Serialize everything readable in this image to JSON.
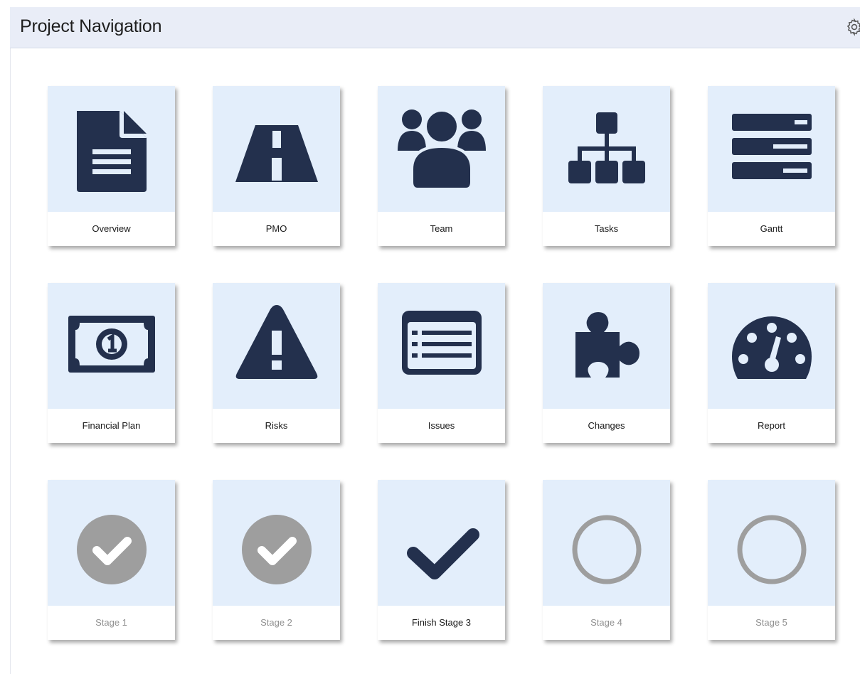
{
  "header": {
    "title": "Project Navigation",
    "settings_icon": "gear-icon"
  },
  "colors": {
    "header_bg": "#e9edf7",
    "tile_bg": "#e3eefb",
    "icon_dark": "#23304d",
    "icon_gray": "#9e9e9e",
    "label_muted": "#909090"
  },
  "tiles": [
    {
      "label": "Overview",
      "icon": "document-icon",
      "state": "active"
    },
    {
      "label": "PMO",
      "icon": "road-icon",
      "state": "active"
    },
    {
      "label": "Team",
      "icon": "users-icon",
      "state": "active"
    },
    {
      "label": "Tasks",
      "icon": "hierarchy-icon",
      "state": "active"
    },
    {
      "label": "Gantt",
      "icon": "gantt-bars-icon",
      "state": "active"
    },
    {
      "label": "Financial Plan",
      "icon": "banknote-icon",
      "state": "active"
    },
    {
      "label": "Risks",
      "icon": "warning-triangle-icon",
      "state": "active"
    },
    {
      "label": "Issues",
      "icon": "list-window-icon",
      "state": "active"
    },
    {
      "label": "Changes",
      "icon": "puzzle-piece-icon",
      "state": "active"
    },
    {
      "label": "Report",
      "icon": "gauge-icon",
      "state": "active"
    },
    {
      "label": "Stage 1",
      "icon": "check-circle-icon",
      "state": "completed"
    },
    {
      "label": "Stage 2",
      "icon": "check-circle-icon",
      "state": "completed"
    },
    {
      "label": "Finish Stage 3",
      "icon": "checkmark-icon",
      "state": "current"
    },
    {
      "label": "Stage 4",
      "icon": "empty-circle-icon",
      "state": "pending"
    },
    {
      "label": "Stage 5",
      "icon": "empty-circle-icon",
      "state": "pending"
    }
  ]
}
